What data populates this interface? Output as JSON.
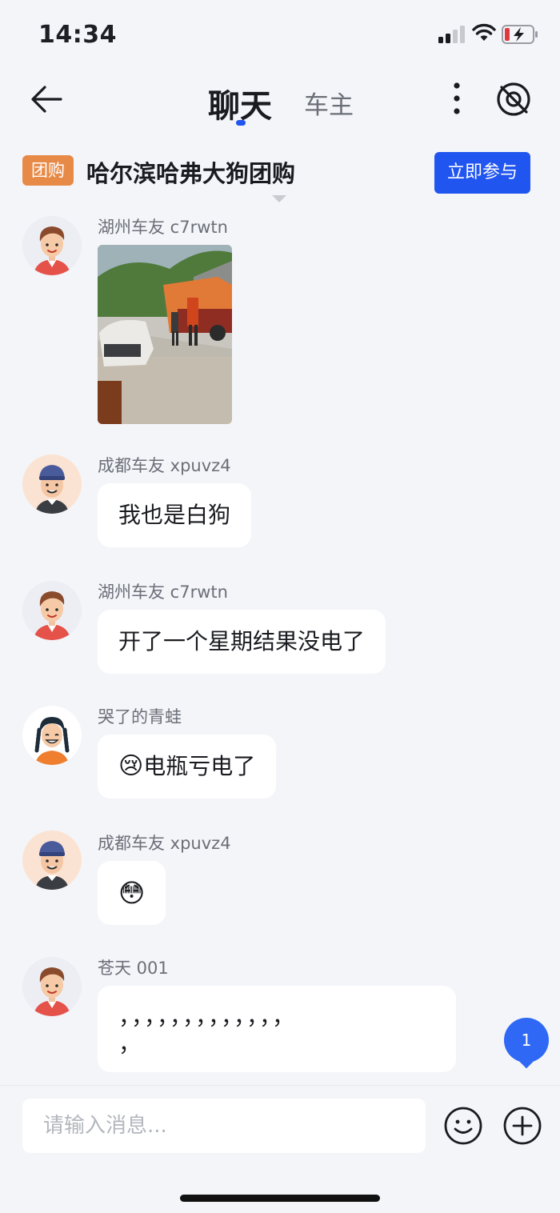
{
  "status": {
    "time": "14:34"
  },
  "header": {
    "tab_chat": "聊天",
    "tab_owner": "车主"
  },
  "group_buy": {
    "badge": "团购",
    "title": "哈尔滨哈弗大狗团购",
    "join_label": "立即参与"
  },
  "messages": [
    {
      "sender": "湖州车友 c7rwtn",
      "type": "image",
      "avatar": "boy-avatar"
    },
    {
      "sender": "成都车友 xpuvz4",
      "text": "我也是白狗",
      "avatar": "cap-avatar"
    },
    {
      "sender": "湖州车友 c7rwtn",
      "text": "开了一个星期结果没电了",
      "avatar": "boy-avatar"
    },
    {
      "sender": "哭了的青蛙",
      "emoji": "😢",
      "text": "电瓶亏电了",
      "avatar": "braids-avatar"
    },
    {
      "sender": "成都车友 xpuvz4",
      "emoji": "😳",
      "avatar": "cap-avatar"
    },
    {
      "sender": "苍天 001",
      "line1": "，，，，，，，，，，，，，",
      "line2": "，",
      "avatar": "boy-avatar"
    }
  ],
  "unread_badge": "1",
  "input": {
    "placeholder": "请输入消息..."
  }
}
